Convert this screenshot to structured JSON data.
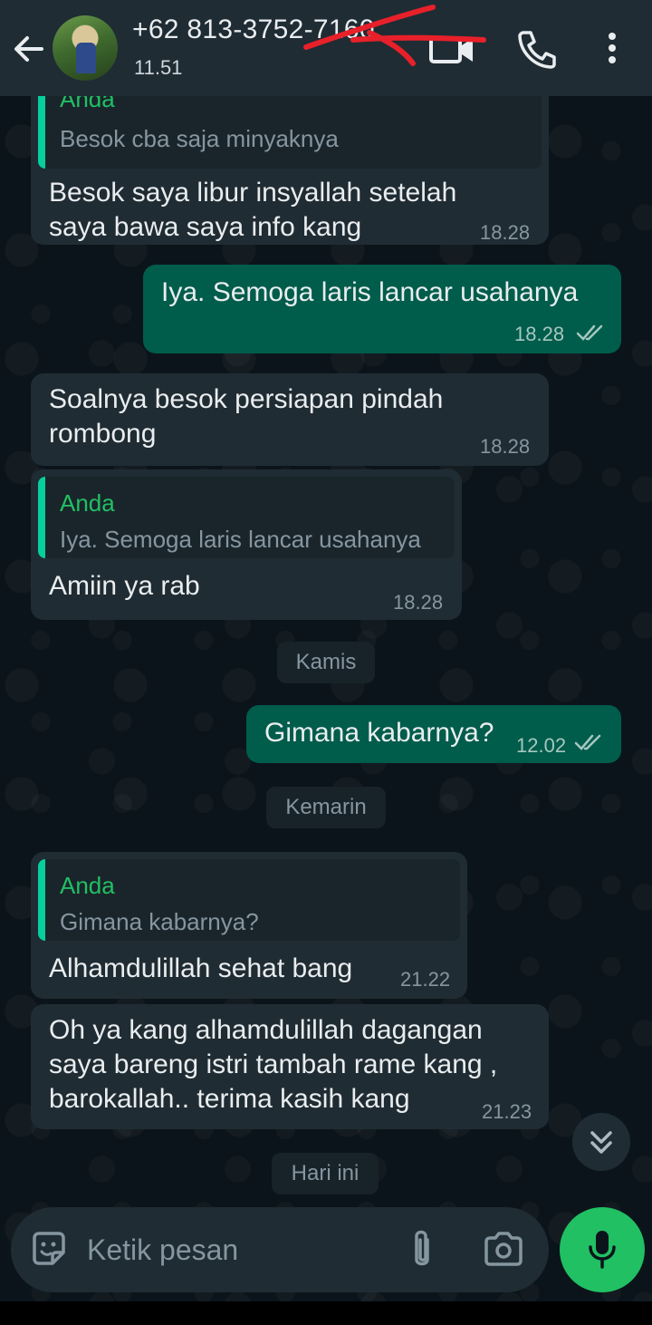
{
  "header": {
    "contact_name": "+62 813-3752-7160",
    "status": "11.51",
    "icons": [
      "back-arrow-icon",
      "video-call-icon",
      "phone-icon",
      "more-vert-icon"
    ]
  },
  "messages": [
    {
      "dir": "in",
      "quote_author": "Anda",
      "quote_text": "Besok cba saja minyaknya",
      "text_lines": [
        "Besok saya libur insyallah setelah",
        "saya bawa saya info kang"
      ],
      "time": "18.28"
    },
    {
      "dir": "out",
      "text_lines": [
        "Iya. Semoga laris lancar usahanya"
      ],
      "time": "18.28"
    },
    {
      "dir": "in",
      "text_lines": [
        "Soalnya besok persiapan pindah",
        "rombong"
      ],
      "time": "18.28"
    },
    {
      "dir": "in",
      "quote_author": "Anda",
      "quote_text": "Iya. Semoga laris lancar usahanya",
      "text_lines": [
        "Amiin ya rab"
      ],
      "time": "18.28"
    },
    {
      "dir": "out",
      "text_lines": [
        "Gimana kabarnya?"
      ],
      "time": "12.02"
    },
    {
      "dir": "in",
      "quote_author": "Anda",
      "quote_text": "Gimana kabarnya?",
      "text_lines": [
        "Alhamdulillah sehat bang"
      ],
      "time": "21.22"
    },
    {
      "dir": "in",
      "text_lines": [
        "Oh ya kang alhamdulillah dagangan",
        "saya bareng istri tambah rame kang ,",
        "barokallah.. terima kasih kang"
      ],
      "time": "21.23"
    }
  ],
  "date_chips": [
    "Kamis",
    "Kemarin",
    "Hari ini"
  ],
  "composer": {
    "placeholder": "Ketik pesan",
    "icons": [
      "sticker-icon",
      "attach-icon",
      "camera-icon",
      "mic-icon"
    ]
  },
  "colors": {
    "header_bg": "#1f2c34",
    "incoming_bubble": "#202c33",
    "outgoing_bubble": "#005c4b",
    "accent_green": "#21c063",
    "redaction_red": "#e8202a"
  }
}
